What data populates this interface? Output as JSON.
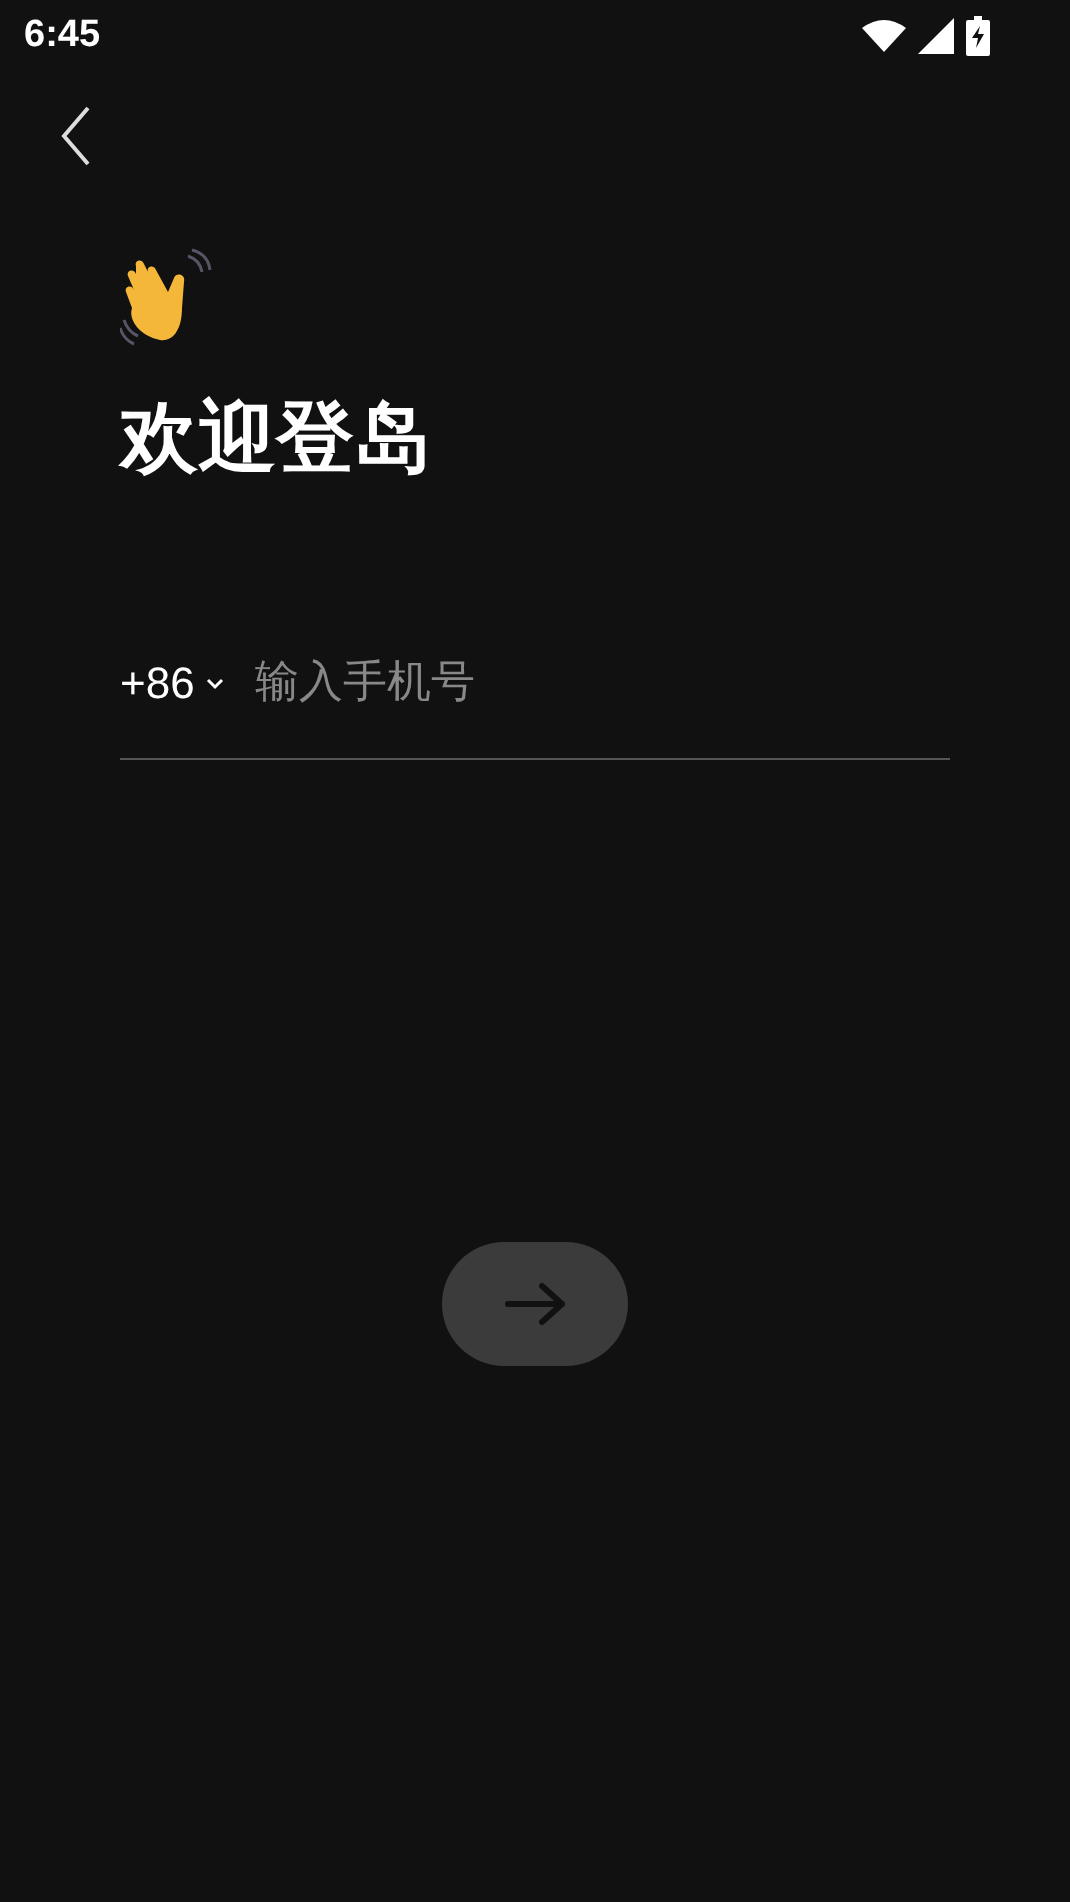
{
  "status_bar": {
    "time": "6:45"
  },
  "title": "欢迎登岛",
  "phone": {
    "country_code": "+86",
    "placeholder": "输入手机号"
  },
  "next_button": {
    "disabled": true
  }
}
